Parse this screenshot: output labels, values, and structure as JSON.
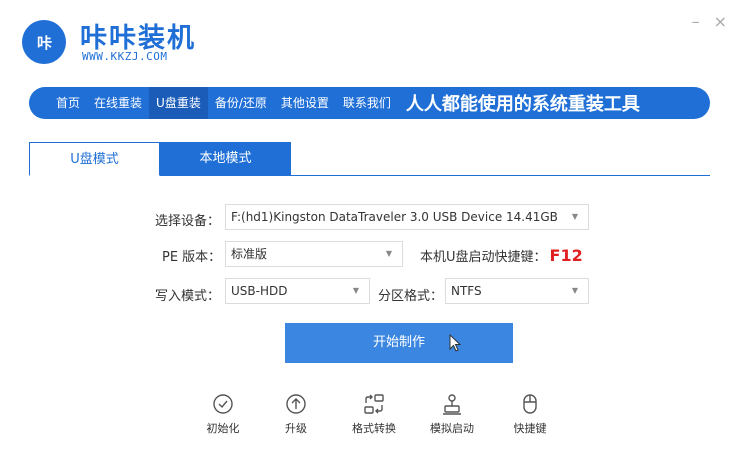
{
  "header": {
    "logo_text": "咔",
    "brand_name": "咔咔装机",
    "brand_url": "WWW.KKZJ.COM",
    "minimize": "–",
    "close": "×"
  },
  "nav": {
    "items": [
      "首页",
      "在线重装",
      "U盘重装",
      "备份/还原",
      "其他设置",
      "联系我们"
    ],
    "active": "U盘重装",
    "slogan": "人人都能使用的系统重装工具"
  },
  "tabs": [
    "U盘模式",
    "本地模式"
  ],
  "form": {
    "device_label": "选择设备：",
    "device_value": "F:(hd1)Kingston DataTraveler 3.0 USB Device 14.41GB",
    "pe_label": "PE 版本：",
    "pe_value": "标准版",
    "hotkey_label": "本机U盘启动快捷键：",
    "hotkey_value": "F12",
    "write_label": "写入模式：",
    "write_value": "USB-HDD",
    "partition_label": "分区格式：",
    "partition_value": "NTFS"
  },
  "start_button": "开始制作",
  "tools": [
    {
      "label": "初始化",
      "icon": "check-circle-icon"
    },
    {
      "label": "升级",
      "icon": "upgrade-arrow-icon"
    },
    {
      "label": "格式转换",
      "icon": "format-convert-icon"
    },
    {
      "label": "模拟启动",
      "icon": "simulate-boot-icon"
    },
    {
      "label": "快捷键",
      "icon": "mouse-icon"
    }
  ],
  "colors": {
    "brand": "#1f6fd6",
    "button": "#3a86e0",
    "hotkey": "#e02020"
  }
}
